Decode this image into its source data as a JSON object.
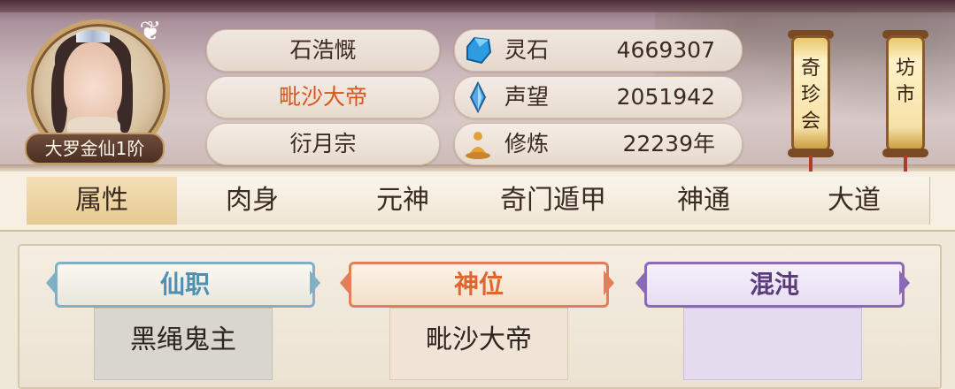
{
  "player": {
    "rank": "大罗金仙1阶",
    "name": "石浩慨",
    "title": "毗沙大帝",
    "sect": "衍月宗"
  },
  "stats": [
    {
      "label": "灵石",
      "value": "4669307",
      "icon": "spirit-stone-icon"
    },
    {
      "label": "声望",
      "value": "2051942",
      "icon": "prestige-crystal-icon"
    },
    {
      "label": "修炼",
      "value": "22239年",
      "icon": "meditation-icon"
    }
  ],
  "shops": {
    "qizhenhui": [
      "奇",
      "珍",
      "会"
    ],
    "fangshi": [
      "坊",
      "市"
    ]
  },
  "tabs": [
    "属性",
    "肉身",
    "元神",
    "奇门遁甲",
    "神通",
    "大道"
  ],
  "active_tab": "属性",
  "cards": [
    {
      "title": "仙职",
      "value": "黑绳鬼主",
      "color": "#4f8fb2"
    },
    {
      "title": "神位",
      "value": "毗沙大帝",
      "color": "#e0662d"
    },
    {
      "title": "混沌",
      "value": "",
      "color": "#5a3c7a"
    }
  ],
  "colors": {
    "title_highlight": "#d8561b",
    "active_tab": "#e6ca92"
  }
}
